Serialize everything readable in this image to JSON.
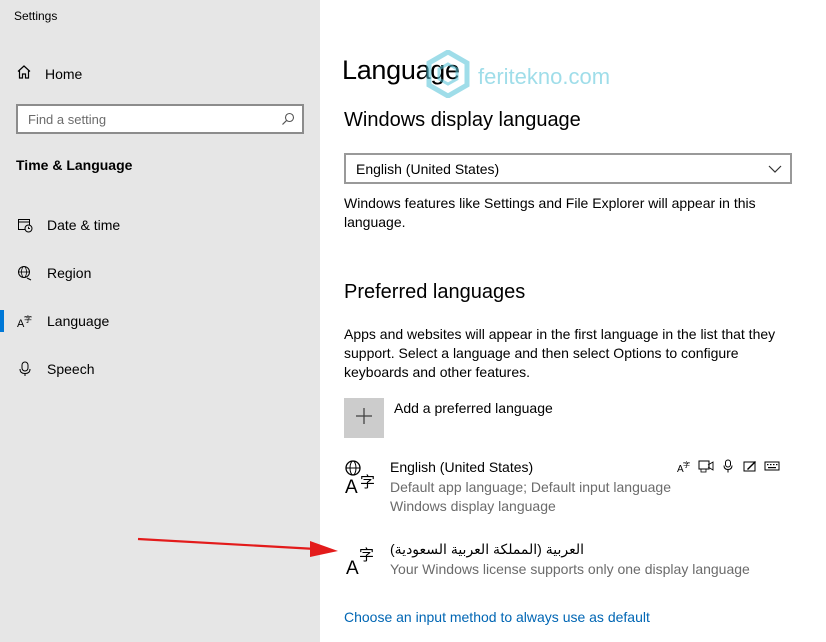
{
  "window": {
    "title": "Settings"
  },
  "sidebar": {
    "home_label": "Home",
    "search_placeholder": "Find a setting",
    "section_title": "Time & Language",
    "items": [
      {
        "label": "Date & time",
        "icon": "calendar-clock-icon"
      },
      {
        "label": "Region",
        "icon": "globe-icon"
      },
      {
        "label": "Language",
        "icon": "language-icon",
        "active": true
      },
      {
        "label": "Speech",
        "icon": "microphone-icon"
      }
    ]
  },
  "main": {
    "title": "Language",
    "watermark": "feritekno.com",
    "display_language": {
      "heading": "Windows display language",
      "selected": "English (United States)",
      "description": "Windows features like Settings and File Explorer will appear in this language."
    },
    "preferred": {
      "heading": "Preferred languages",
      "description": "Apps and websites will appear in the first language in the list that they support. Select a language and then select Options to configure keyboards and other features.",
      "add_label": "Add a preferred language",
      "languages": [
        {
          "name": "English (United States)",
          "line1": "Default app language; Default input language",
          "line2": "Windows display language"
        },
        {
          "name": "العربية (المملكة العربية السعودية)",
          "line1": "Your Windows license supports only one display language"
        }
      ]
    },
    "link": "Choose an input method to always use as default"
  },
  "colors": {
    "accent": "#0078d7",
    "link": "#0066b4",
    "sidebar_bg": "#e6e6e6",
    "arrow": "#e31b1b",
    "watermark": "#52c3d8"
  }
}
